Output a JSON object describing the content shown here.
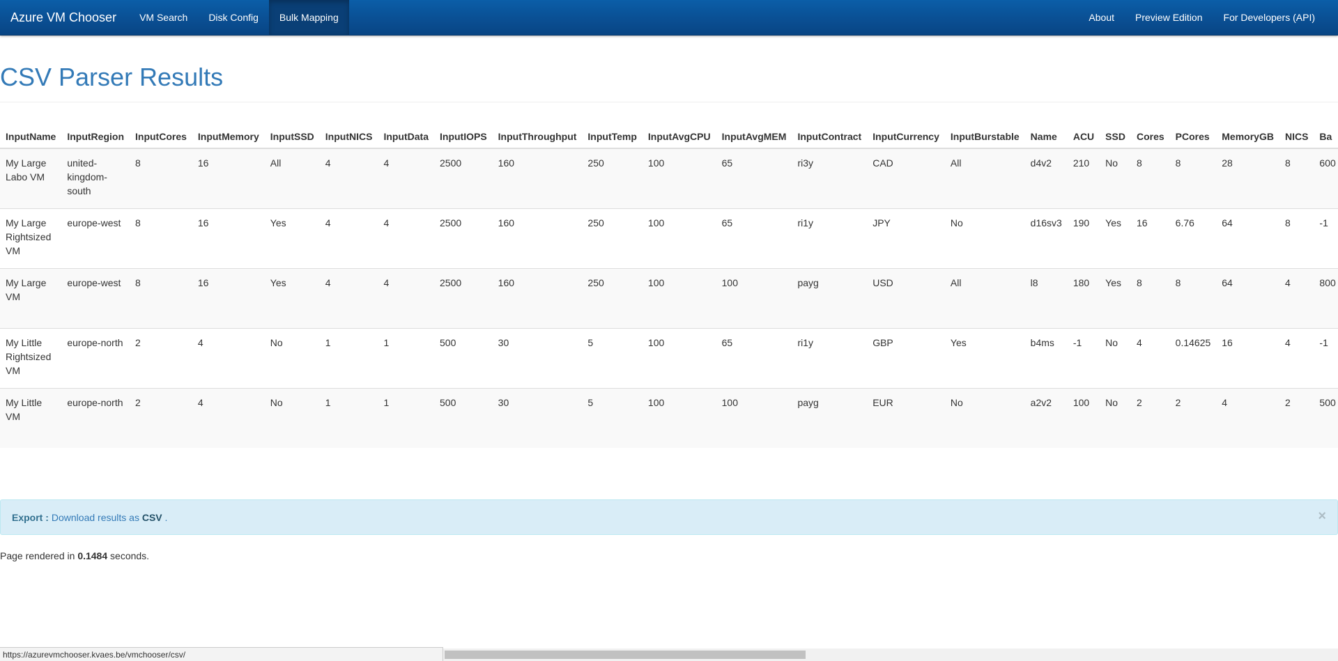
{
  "navbar": {
    "brand": "Azure VM Chooser",
    "left_items": [
      {
        "label": "VM Search",
        "active": false
      },
      {
        "label": "Disk Config",
        "active": false
      },
      {
        "label": "Bulk Mapping",
        "active": true
      }
    ],
    "right_items": [
      {
        "label": "About"
      },
      {
        "label": "Preview Edition"
      },
      {
        "label": "For Developers (API)"
      }
    ]
  },
  "page": {
    "title": "CSV Parser Results"
  },
  "table": {
    "columns": [
      "InputName",
      "InputRegion",
      "InputCores",
      "InputMemory",
      "InputSSD",
      "InputNICS",
      "InputData",
      "InputIOPS",
      "InputThroughput",
      "InputTemp",
      "InputAvgCPU",
      "InputAvgMEM",
      "InputContract",
      "InputCurrency",
      "InputBurstable",
      "Name",
      "ACU",
      "SSD",
      "Cores",
      "PCores",
      "MemoryGB",
      "NICS",
      "Ba"
    ],
    "rows": [
      [
        "My Large Labo VM",
        "united-kingdom-south",
        "8",
        "16",
        "All",
        "4",
        "4",
        "2500",
        "160",
        "250",
        "100",
        "65",
        "ri3y",
        "CAD",
        "All",
        "d4v2",
        "210",
        "No",
        "8",
        "8",
        "28",
        "8",
        "600"
      ],
      [
        "My Large Rightsized VM",
        "europe-west",
        "8",
        "16",
        "Yes",
        "4",
        "4",
        "2500",
        "160",
        "250",
        "100",
        "65",
        "ri1y",
        "JPY",
        "No",
        "d16sv3",
        "190",
        "Yes",
        "16",
        "6.76",
        "64",
        "8",
        "-1"
      ],
      [
        "My Large VM",
        "europe-west",
        "8",
        "16",
        "Yes",
        "4",
        "4",
        "2500",
        "160",
        "250",
        "100",
        "100",
        "payg",
        "USD",
        "All",
        "l8",
        "180",
        "Yes",
        "8",
        "8",
        "64",
        "4",
        "800"
      ],
      [
        "My Little Rightsized VM",
        "europe-north",
        "2",
        "4",
        "No",
        "1",
        "1",
        "500",
        "30",
        "5",
        "100",
        "65",
        "ri1y",
        "GBP",
        "Yes",
        "b4ms",
        "-1",
        "No",
        "4",
        "0.14625",
        "16",
        "4",
        "-1"
      ],
      [
        "My Little VM",
        "europe-north",
        "2",
        "4",
        "No",
        "1",
        "1",
        "500",
        "30",
        "5",
        "100",
        "100",
        "payg",
        "EUR",
        "No",
        "a2v2",
        "100",
        "No",
        "2",
        "2",
        "4",
        "2",
        "500"
      ]
    ]
  },
  "alert": {
    "label": "Export :",
    "link_text": "Download results as",
    "link_bold": "CSV",
    "trailing": ".",
    "close_glyph": "×"
  },
  "footer": {
    "prefix": "Page rendered in",
    "seconds": "0.1484",
    "suffix": "seconds."
  },
  "status_bar": {
    "url": "https://azurevmchooser.kvaes.be/vmchooser/csv/"
  }
}
